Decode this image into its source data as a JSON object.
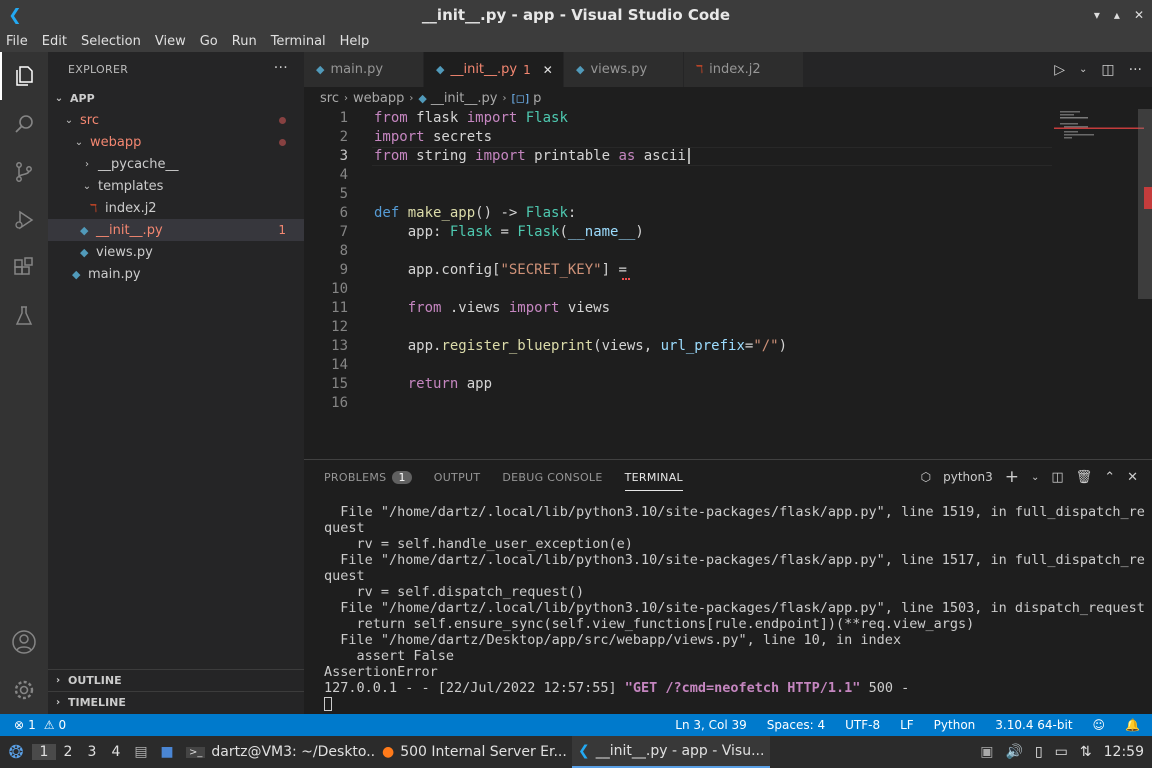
{
  "window": {
    "title": "__init__.py - app - Visual Studio Code"
  },
  "menu": [
    "File",
    "Edit",
    "Selection",
    "View",
    "Go",
    "Run",
    "Terminal",
    "Help"
  ],
  "sidebar": {
    "header": "EXPLORER",
    "root": "APP",
    "tree": [
      {
        "label": "src",
        "kind": "folder-open"
      },
      {
        "label": "webapp",
        "kind": "folder-open"
      },
      {
        "label": "__pycache__",
        "kind": "folder-closed"
      },
      {
        "label": "templates",
        "kind": "folder-open"
      },
      {
        "label": "index.j2",
        "kind": "j2"
      },
      {
        "label": "__init__.py",
        "kind": "py",
        "badge": "1"
      },
      {
        "label": "views.py",
        "kind": "py"
      },
      {
        "label": "main.py",
        "kind": "py"
      }
    ],
    "outline": "OUTLINE",
    "timeline": "TIMELINE"
  },
  "tabs": [
    {
      "label": "main.py"
    },
    {
      "label": "__init__.py",
      "badge": "1"
    },
    {
      "label": "views.py"
    },
    {
      "label": "index.j2"
    }
  ],
  "breadcrumb": [
    "src",
    "webapp",
    "__init__.py",
    "p"
  ],
  "editor": {
    "line_numbers": [
      "1",
      "2",
      "3",
      "4",
      "5",
      "6",
      "7",
      "8",
      "9",
      "10",
      "11",
      "12",
      "13",
      "14",
      "15",
      "16"
    ]
  },
  "panel": {
    "tabs": [
      "PROBLEMS",
      "OUTPUT",
      "DEBUG CONSOLE",
      "TERMINAL"
    ],
    "problems_count": "1",
    "terminal_name": "python3",
    "lines": [
      "  File \"/home/dartz/.local/lib/python3.10/site-packages/flask/app.py\", line 1519, in full_dispatch_re",
      "quest",
      "    rv = self.handle_user_exception(e)",
      "  File \"/home/dartz/.local/lib/python3.10/site-packages/flask/app.py\", line 1517, in full_dispatch_re",
      "quest",
      "    rv = self.dispatch_request()",
      "  File \"/home/dartz/.local/lib/python3.10/site-packages/flask/app.py\", line 1503, in dispatch_request",
      "    return self.ensure_sync(self.view_functions[rule.endpoint])(**req.view_args)",
      "  File \"/home/dartz/Desktop/app/src/webapp/views.py\", line 10, in index",
      "    assert False",
      "AssertionError"
    ],
    "last_line_prefix": "127.0.0.1 - - [22/Jul/2022 12:57:55] ",
    "last_line_request": "\"GET /?cmd=neofetch HTTP/1.1\"",
    "last_line_suffix": " 500 -"
  },
  "statusbar": {
    "errors": "1",
    "warnings": "0",
    "position": "Ln 3, Col 39",
    "spaces": "Spaces: 4",
    "encoding": "UTF-8",
    "eol": "LF",
    "language": "Python",
    "interpreter": "3.10.4 64-bit"
  },
  "taskbar": {
    "workspaces": [
      "1",
      "2",
      "3",
      "4"
    ],
    "tasks": [
      {
        "label": "dartz@VM3: ~/Deskto..."
      },
      {
        "label": "500 Internal Server Er..."
      },
      {
        "label": "__init__.py - app - Visu..."
      }
    ],
    "clock": "12:59"
  }
}
